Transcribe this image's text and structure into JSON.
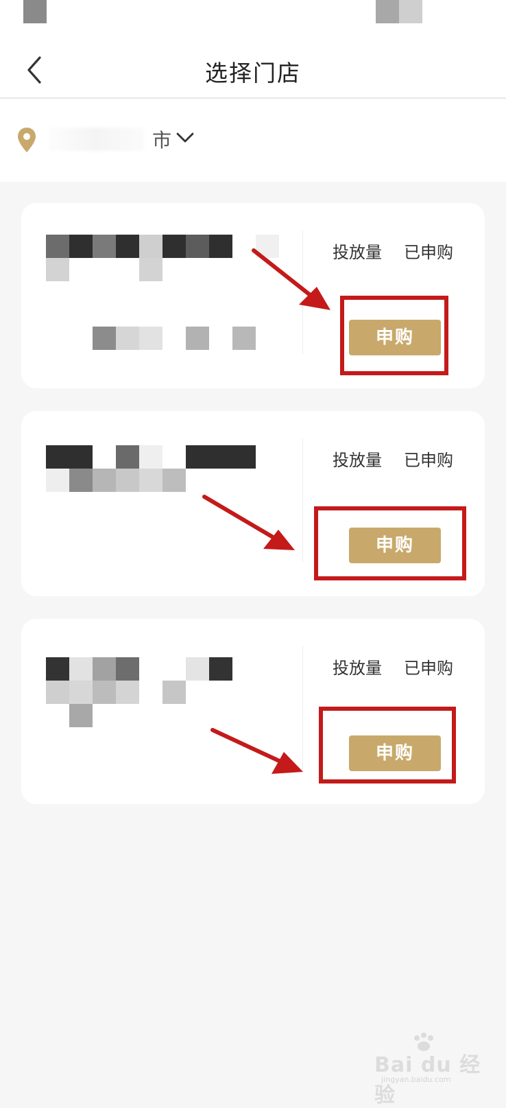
{
  "header": {
    "title": "选择门店",
    "back_icon": "chevron-left-icon"
  },
  "location": {
    "city_suffix": "市",
    "pin_icon": "location-pin-icon",
    "dropdown_icon": "chevron-down-icon"
  },
  "stores": [
    {
      "stat_1": "投放量",
      "stat_2": "已申购",
      "button": "申购"
    },
    {
      "stat_1": "投放量",
      "stat_2": "已申购",
      "button": "申购"
    },
    {
      "stat_1": "投放量",
      "stat_2": "已申购",
      "button": "申购"
    }
  ],
  "watermark": {
    "brand": "Bai du 经验",
    "url": "jingyan.baidu.com"
  },
  "colors": {
    "accent_gold": "#c8a96b",
    "highlight_red": "#c41a1a",
    "page_bg": "#f6f6f6"
  }
}
